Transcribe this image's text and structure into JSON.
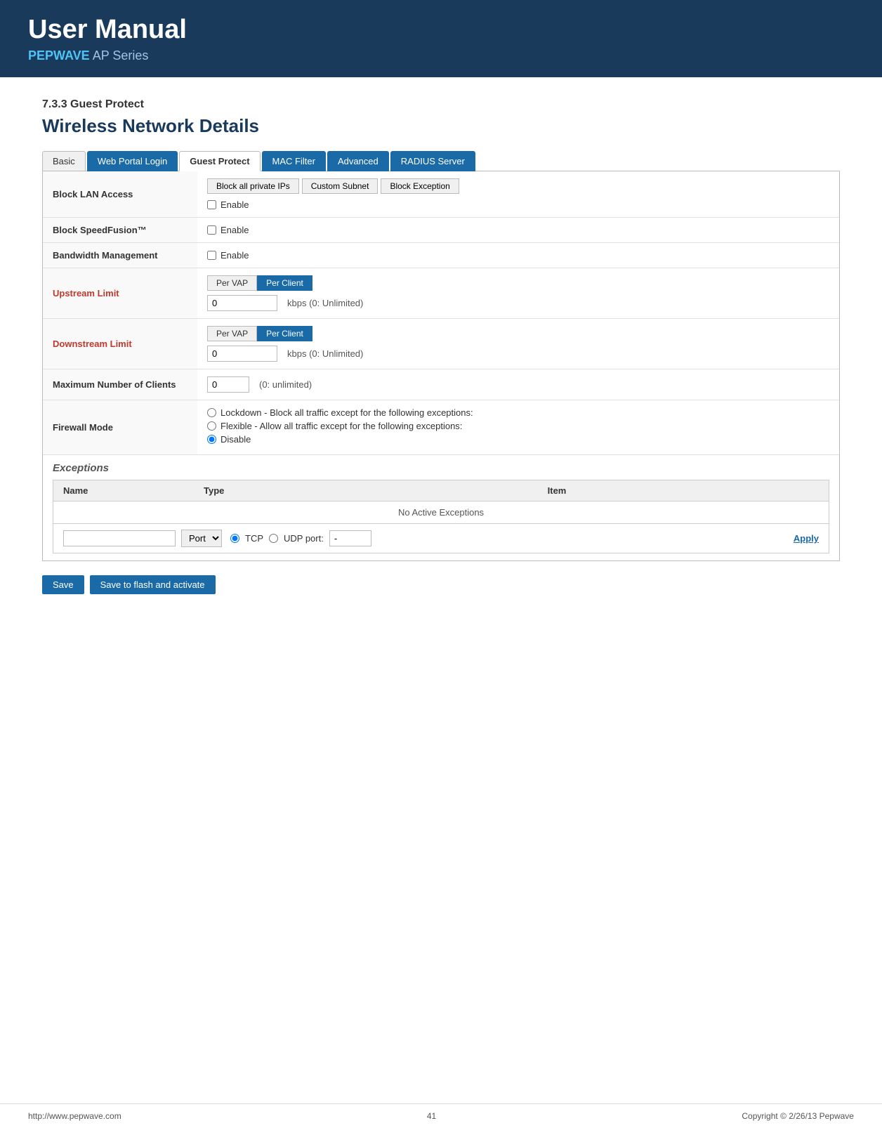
{
  "header": {
    "title": "User Manual",
    "subtitle_brand": "PEPWAVE",
    "subtitle_rest": " AP Series"
  },
  "page": {
    "section": "7.3.3 Guest Protect",
    "network_details": "Wireless Network Details"
  },
  "tabs": {
    "items": [
      {
        "label": "Basic",
        "active": false,
        "highlight": false
      },
      {
        "label": "Web Portal Login",
        "active": false,
        "highlight": true
      },
      {
        "label": "Guest Protect",
        "active": true,
        "highlight": false
      },
      {
        "label": "MAC Filter",
        "active": false,
        "highlight": true
      },
      {
        "label": "Advanced",
        "active": false,
        "highlight": true
      },
      {
        "label": "RADIUS Server",
        "active": false,
        "highlight": true
      }
    ]
  },
  "form": {
    "block_lan_access": {
      "label": "Block LAN Access",
      "subnet_buttons": [
        {
          "label": "Block all private IPs",
          "active": false
        },
        {
          "label": "Custom Subnet",
          "active": false
        },
        {
          "label": "Block Exception",
          "active": false
        }
      ],
      "enable_label": "Enable",
      "enable_checked": false
    },
    "block_speedfusion": {
      "label": "Block SpeedFusion™",
      "enable_label": "Enable",
      "enable_checked": false
    },
    "bandwidth_management": {
      "label": "Bandwidth Management",
      "enable_label": "Enable",
      "enable_checked": false
    },
    "upstream_limit": {
      "label": "Upstream Limit",
      "tabs": [
        {
          "label": "Per VAP",
          "active": false
        },
        {
          "label": "Per Client",
          "active": true
        }
      ],
      "value": "0",
      "unit": "kbps (0: Unlimited)"
    },
    "downstream_limit": {
      "label": "Downstream Limit",
      "tabs": [
        {
          "label": "Per VAP",
          "active": false
        },
        {
          "label": "Per Client",
          "active": true
        }
      ],
      "value": "0",
      "unit": "kbps (0: Unlimited)"
    },
    "max_clients": {
      "label": "Maximum Number of Clients",
      "value": "0",
      "unit": "(0: unlimited)"
    },
    "firewall_mode": {
      "label": "Firewall Mode",
      "options": [
        {
          "label": "Lockdown - Block all traffic except for the following exceptions:",
          "checked": false
        },
        {
          "label": "Flexible - Allow all traffic except for the following exceptions:",
          "checked": false
        },
        {
          "label": "Disable",
          "checked": true
        }
      ]
    }
  },
  "exceptions": {
    "section_label": "Exceptions",
    "table_headers": {
      "name": "Name",
      "type": "Type",
      "item": "Item"
    },
    "no_exceptions": "No Active Exceptions",
    "add_row": {
      "type_select": "Port",
      "tcp_label": "TCP",
      "udp_label": "UDP port:",
      "dash": "-",
      "apply_label": "Apply"
    }
  },
  "buttons": {
    "save": "Save",
    "save_flash": "Save to flash and activate"
  },
  "footer": {
    "url": "http://www.pepwave.com",
    "page_number": "41",
    "copyright": "Copyright © 2/26/13 Pepwave"
  }
}
